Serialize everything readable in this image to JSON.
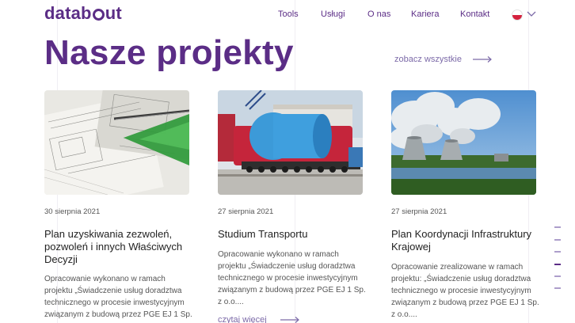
{
  "header": {
    "logo_text_a": "datab",
    "logo_text_b": "ut",
    "nav": [
      {
        "label": "Tools"
      },
      {
        "label": "Usługi"
      },
      {
        "label": "O nas"
      },
      {
        "label": "Kariera"
      },
      {
        "label": "Kontakt"
      }
    ],
    "language": {
      "icon": "flag-pl-icon",
      "chevron": "chevron-down-icon"
    }
  },
  "hero": {
    "title": "Nasze projekty",
    "see_all": "zobacz wszystkie"
  },
  "projects": [
    {
      "date": "30 sierpnia 2021",
      "title": "Plan uzyskiwania zezwoleń, pozwoleń i innych Właściwych Decyzji",
      "excerpt": "Opracowanie wykonano w ramach projektu „Świadczenie usług doradztwa technicznego w procesie inwestycyjnym związanym z budową przez PGE EJ 1 Sp.",
      "image": "technical-drawings-image"
    },
    {
      "date": "27 sierpnia 2021",
      "title": "Studium Transportu",
      "excerpt": "Opracowanie wykonano w ramach projektu „Świadczenie usług doradztwa technicznego w procesie inwestycyjnym związanym z budową przez PGE EJ 1 Sp. z o.o....",
      "read_more": "czytaj więcej",
      "image": "heavy-transport-image"
    },
    {
      "date": "27 sierpnia 2021",
      "title": "Plan Koordynacji Infrastruktury Krajowej",
      "excerpt": "Opracowanie zrealizowane w ramach projektu: „Świadczenie usług doradztwa technicznego w procesie inwestycyjnym związanym z budową przez PGE EJ 1 Sp. z o.o....",
      "image": "cooling-towers-image"
    }
  ],
  "colors": {
    "brand": "#5b2d86",
    "link": "#7c6aa8"
  }
}
